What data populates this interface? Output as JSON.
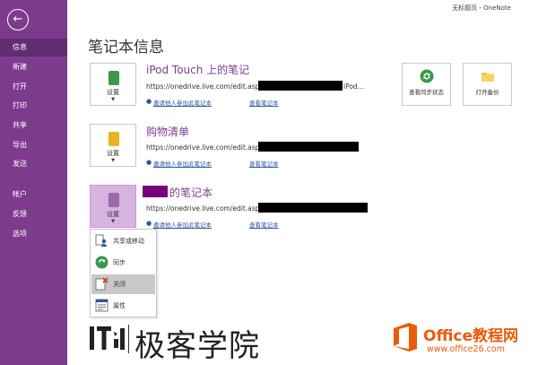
{
  "window": {
    "title": "无标题页  -  OneNote"
  },
  "sidebar": {
    "back_icon": "back-arrow-icon",
    "items": [
      {
        "label": "信息",
        "active": true
      },
      {
        "label": "新建"
      },
      {
        "label": "打开"
      },
      {
        "label": "打印"
      },
      {
        "label": "共享"
      },
      {
        "label": "导出"
      },
      {
        "label": "发送"
      },
      {
        "label": "帐户"
      },
      {
        "label": "反馈"
      },
      {
        "label": "选项"
      }
    ]
  },
  "page": {
    "title": "笔记本信息"
  },
  "notebooks": [
    {
      "name": "iPod Touch 上的笔记",
      "url_prefix": "https://onedrive.live.com/edit.aspx/",
      "url_suffix": "iPod...",
      "settings_label": "设置",
      "invite_label": "邀请他人参加此笔记本",
      "view_label": "查看笔记本",
      "color": "#3a9a4a"
    },
    {
      "name": "购物清单",
      "url_prefix": "https://onedrive.live.com/edit.aspx/",
      "settings_label": "设置",
      "invite_label": "邀请他人参加此笔记本",
      "view_label": "查看笔记本",
      "color": "#e6b422"
    },
    {
      "name_suffix": "的笔记本",
      "url_prefix": "https://onedrive.live.com/edit.aspx/",
      "settings_label": "设置",
      "invite_label": "邀请他人参加此笔记本",
      "view_label": "查看笔记本",
      "color": "#7d3b8e"
    }
  ],
  "actions": {
    "sync_label": "查看同步状态",
    "backup_label": "打开备份"
  },
  "dropdown": {
    "items": [
      {
        "label": "共享或移动",
        "icon": "share-move-icon"
      },
      {
        "label": "同步",
        "icon": "sync-icon"
      },
      {
        "label": "关闭",
        "icon": "close-notebook-icon",
        "highlighted": true
      },
      {
        "label": "属性",
        "icon": "properties-icon"
      }
    ]
  },
  "watermarks": {
    "ithome_text": "极客学院",
    "office_title": "Office教程网",
    "office_url": "www.office26.com"
  },
  "colors": {
    "sidebar": "#7d3b8e",
    "sidebar_active": "#612c71",
    "accent_orange": "#ea5b0c",
    "link": "#2b579a"
  }
}
